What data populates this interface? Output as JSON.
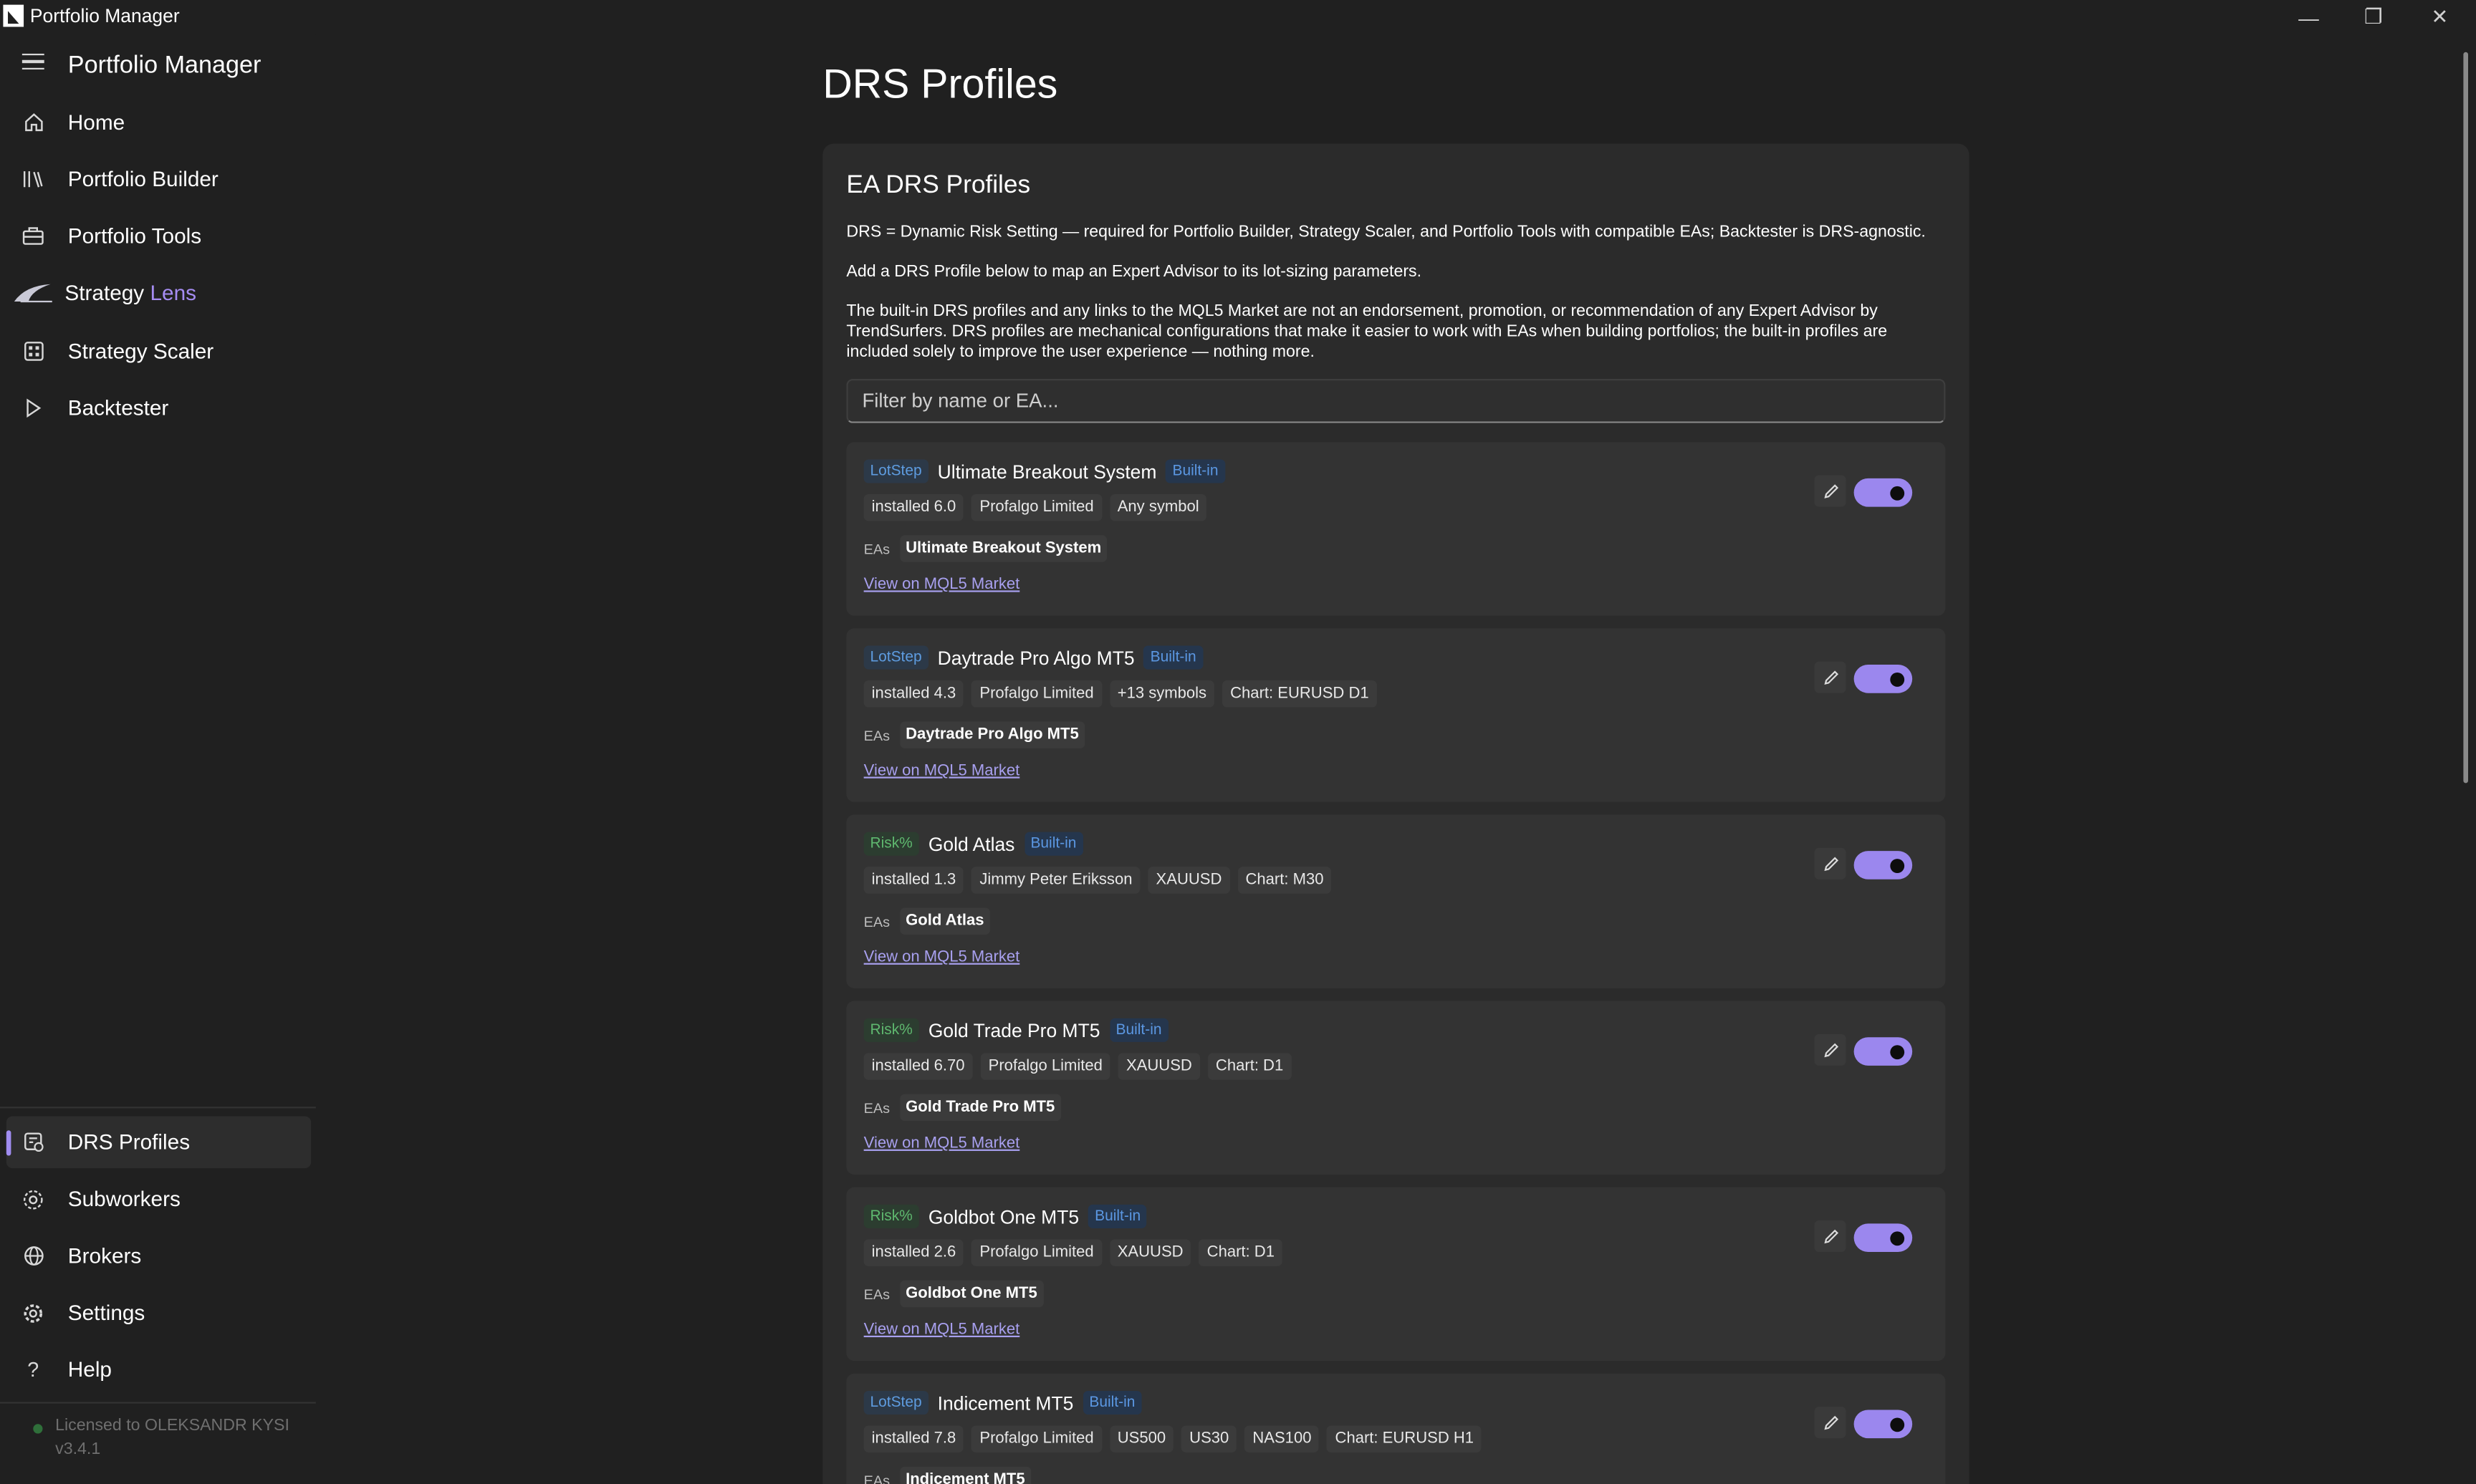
{
  "window": {
    "title": "Portfolio Manager",
    "minimize": "—",
    "restore": "❐",
    "close": "✕"
  },
  "sidebar": {
    "title": "Portfolio Manager",
    "items": [
      {
        "label": "Home",
        "icon": "home-icon"
      },
      {
        "label": "Portfolio Builder",
        "icon": "library-icon"
      },
      {
        "label": "Portfolio Tools",
        "icon": "toolbox-icon"
      },
      {
        "label": "Strategy",
        "label2": "Lens",
        "icon": "lens-logo-icon"
      },
      {
        "label": "Strategy Scaler",
        "icon": "grid-icon"
      },
      {
        "label": "Backtester",
        "icon": "play-icon"
      }
    ],
    "bottom_items": [
      {
        "label": "DRS Profiles",
        "icon": "profiles-icon",
        "active": true
      },
      {
        "label": "Subworkers",
        "icon": "gear-cluster-icon"
      },
      {
        "label": "Brokers",
        "icon": "globe-icon"
      },
      {
        "label": "Settings",
        "icon": "gear-icon"
      },
      {
        "label": "Help",
        "icon": "question-icon"
      }
    ],
    "license": "Licensed to OLEKSANDR KYSI",
    "version": "v3.4.1"
  },
  "main": {
    "page_title": "DRS Profiles",
    "panel_title": "EA DRS Profiles",
    "desc1": "DRS = Dynamic Risk Setting — required for Portfolio Builder, Strategy Scaler, and Portfolio Tools with compatible EAs; Backtester is DRS-agnostic.",
    "desc2": "Add a DRS Profile below to map an Expert Advisor to its lot-sizing parameters.",
    "desc3": "The built-in DRS profiles and any links to the MQL5 Market are not an endorsement, promotion, or recommendation of any Expert Advisor by TrendSurfers. DRS profiles are mechanical configurations that make it easier to work with EAs when building portfolios; the built-in profiles are included solely to improve the user experience — nothing more.",
    "filter_placeholder": "Filter by name or EA...",
    "eas_label": "EAs",
    "link_label": "View on MQL5 Market",
    "builtin_label": "Built-in",
    "profiles": [
      {
        "type": "LotStep",
        "name": "Ultimate Breakout System",
        "chips": [
          "installed 6.0",
          "Profalgo Limited",
          "Any symbol"
        ],
        "ea": "Ultimate Breakout System",
        "enabled": true
      },
      {
        "type": "LotStep",
        "name": "Daytrade Pro Algo MT5",
        "chips": [
          "installed 4.3",
          "Profalgo Limited",
          "+13 symbols",
          "Chart: EURUSD D1"
        ],
        "ea": "Daytrade Pro Algo MT5",
        "enabled": true
      },
      {
        "type": "Risk%",
        "name": "Gold Atlas",
        "chips": [
          "installed 1.3",
          "Jimmy Peter Eriksson",
          "XAUUSD",
          "Chart: M30"
        ],
        "ea": "Gold Atlas",
        "enabled": true
      },
      {
        "type": "Risk%",
        "name": "Gold Trade Pro MT5",
        "chips": [
          "installed 6.70",
          "Profalgo Limited",
          "XAUUSD",
          "Chart: D1"
        ],
        "ea": "Gold Trade Pro MT5",
        "enabled": true
      },
      {
        "type": "Risk%",
        "name": "Goldbot One MT5",
        "chips": [
          "installed 2.6",
          "Profalgo Limited",
          "XAUUSD",
          "Chart: D1"
        ],
        "ea": "Goldbot One MT5",
        "enabled": true
      },
      {
        "type": "LotStep",
        "name": "Indicement MT5",
        "chips": [
          "installed 7.8",
          "Profalgo Limited",
          "US500",
          "US30",
          "NAS100",
          "Chart: EURUSD H1"
        ],
        "ea": "Indicement MT5",
        "enabled": true
      }
    ]
  },
  "colors": {
    "accent": "#9b87ee",
    "background": "#202020",
    "panel": "#2b2b2b",
    "card": "#333333",
    "lotstep": "#5e9ce0",
    "risk": "#5fb86f",
    "link": "#a8a0ef"
  }
}
